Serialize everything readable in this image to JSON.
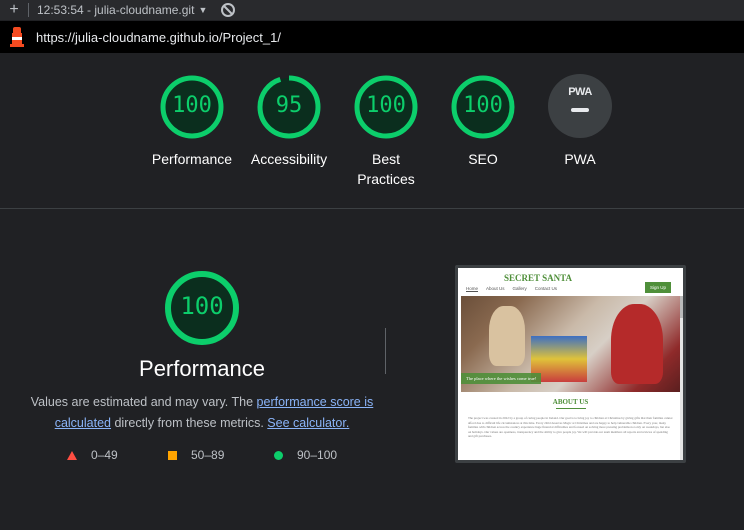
{
  "topbar": {
    "plus_icon": "plus-icon",
    "title": "12:53:54 - julia-cloudname.git",
    "caret": "▼",
    "block_icon": "no-entry-icon"
  },
  "urlbar": {
    "logo_icon": "lighthouse-icon",
    "url": "https://julia-cloudname.github.io/Project_1/"
  },
  "categories": [
    {
      "score": "100",
      "label": "Performance",
      "value": 100
    },
    {
      "score": "95",
      "label": "Accessibility",
      "value": 95
    },
    {
      "score": "100",
      "label_line1": "Best",
      "label_line2": "Practices",
      "value": 100
    },
    {
      "score": "100",
      "label": "SEO",
      "value": 100
    },
    {
      "badge_text": "PWA",
      "label": "PWA"
    }
  ],
  "colors": {
    "pass": "#0cce6b",
    "average": "#ffa400",
    "fail": "#ff4e42"
  },
  "performance": {
    "score": "100",
    "title": "Performance",
    "desc_1": "Values are estimated and may vary. The ",
    "link_1": "performance score is calculated",
    "desc_2": " directly from these metrics. ",
    "link_2": "See calculator."
  },
  "legend": [
    {
      "range": "0–49",
      "icon": "triangle-icon"
    },
    {
      "range": "50–89",
      "icon": "square-icon"
    },
    {
      "range": "90–100",
      "icon": "circle-icon"
    }
  ],
  "screenshot": {
    "brand": "SECRET SANTA",
    "nav": [
      "Home",
      "About Us",
      "Gallery",
      "Contact Us"
    ],
    "signup": "Sign Up",
    "caption": "The place where the wishes come true!",
    "heading": "ABOUT US",
    "paragraph": "The project was created in 2022 by a group of caring people in Ireland. Our goal is to bring joy to children at Christmas by giving gifts that their families cannot afford due to difficult life circumstances at this time. Every child deserves Magic at Christmas and are happy to help vulnerable children. Every year, many families with children across the country experience huge financial difficulties and focused on solving more pressing problems not only on weekdays, but also on holidays. Our values are openness, transparency and the ability to give people joy. We will provide our team members all reports and reviews of spending and gift purchases."
  }
}
